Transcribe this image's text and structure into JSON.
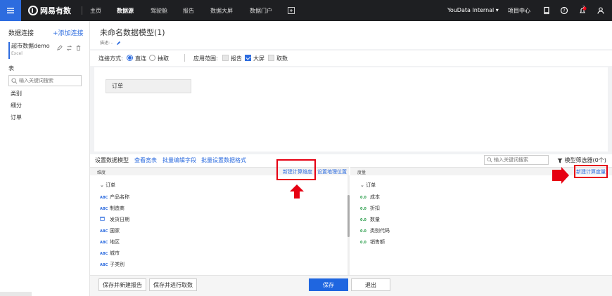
{
  "topbar": {
    "logo": "网易有数",
    "nav": [
      "主页",
      "数据源",
      "驾驶舱",
      "报告",
      "数据大屏",
      "数据门户"
    ],
    "active_nav": "数据源",
    "user": "YouData Internal ▾",
    "project_center": "项目中心",
    "notification_count": "2"
  },
  "sidebar": {
    "title": "数据连接",
    "add": "+添加连接",
    "datasource": {
      "name": "超市数据demo",
      "type": "Excel"
    },
    "table_label": "表",
    "search_placeholder": "输入关键词搜索",
    "items": [
      "类别",
      "细分",
      "订单"
    ]
  },
  "model": {
    "title": "未命名数据模型(1)",
    "desc": "描述: -"
  },
  "connection": {
    "label": "连接方式:",
    "direct": "直连",
    "extract": "抽取",
    "scope_label": "应用范围:",
    "scope_report": "报告",
    "scope_screen": "大屏",
    "scope_fetch": "取数"
  },
  "canvas": {
    "table_card": "订单"
  },
  "fields_toolbar": {
    "tabs": [
      "设置数据模型",
      "查看宽表",
      "批量编辑字段",
      "批量设置数据格式"
    ],
    "search_placeholder": "输入关键词搜索",
    "filter": "模型筛选器(0个)"
  },
  "dimensions": {
    "header": "维度",
    "new_calc": "新建计算维度",
    "geo": "设置地理位置",
    "group": "订单",
    "fields": [
      {
        "type": "ABC",
        "name": "产品名称"
      },
      {
        "type": "ABC",
        "name": "制造商"
      },
      {
        "type": "date",
        "name": "发货日期"
      },
      {
        "type": "ABC",
        "name": "国家"
      },
      {
        "type": "ABC",
        "name": "地区"
      },
      {
        "type": "ABC",
        "name": "城市"
      },
      {
        "type": "ABC",
        "name": "子类别"
      }
    ]
  },
  "measures": {
    "header": "度量",
    "new_calc": "新建计算度量",
    "group": "订单",
    "fields": [
      {
        "type": "0.0",
        "name": "成本"
      },
      {
        "type": "0.0",
        "name": "折扣"
      },
      {
        "type": "0.0",
        "name": "数量"
      },
      {
        "type": "0.0",
        "name": "类别代码"
      },
      {
        "type": "0.0",
        "name": "销售额"
      }
    ]
  },
  "footer": {
    "save_new_report": "保存并新建报告",
    "save_fetch": "保存并进行取数",
    "save": "保存",
    "exit": "退出"
  },
  "colors": {
    "accent": "#2d6cdf",
    "highlight": "#e60012",
    "topbar": "#1e1f22"
  }
}
